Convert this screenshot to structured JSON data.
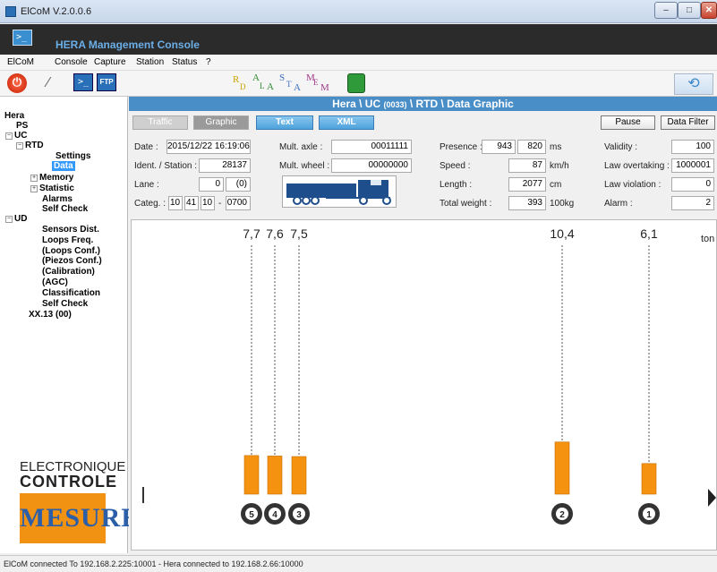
{
  "window": {
    "title": "ElCoM V.2.0.0.6",
    "min": "–",
    "max": "□",
    "close": "✕"
  },
  "banner": {
    "title": "HERA Management Console",
    "icon_glyph": ">_"
  },
  "menu": [
    "ElCoM",
    "Console",
    "Capture",
    "Station",
    "Status",
    "?"
  ],
  "toolbar": {
    "power_icon": "power-icon",
    "cmd_glyph": ">_",
    "ftp_label": "FTP",
    "rlsm": [
      "R",
      "D",
      "A",
      "L",
      "S",
      "T",
      "M",
      "E",
      "M",
      "A",
      "L",
      "A"
    ],
    "refresh_glyph": "⟲"
  },
  "tree": {
    "hera": "Hera",
    "ps": "PS",
    "uc": "UC",
    "rtd": "RTD",
    "settings": "Settings",
    "data": "Data",
    "memory": "Memory",
    "statistic": "Statistic",
    "alarms": "Alarms",
    "uc_self_check": "Self Check",
    "ud": "UD",
    "sensors_dist": "Sensors Dist.",
    "loops_freq": "Loops Freq.",
    "loops_conf": "(Loops Conf.)",
    "piezos_conf": "(Piezos Conf.)",
    "calibration": "(Calibration)",
    "agc": "(AGC)",
    "classification": "Classification",
    "ud_self_check": "Self Check",
    "xx13": "XX.13 (00)"
  },
  "logo": {
    "line1": "ELECTRONIQUE",
    "line2": "CONTROLE",
    "line3": "MESURE"
  },
  "breadcrumb": {
    "pre": "Hera \\ UC ",
    "code": "(0033)",
    "post": " \\ RTD \\ Data Graphic"
  },
  "tabs": {
    "traffic": "Traffic",
    "graphic": "Graphic",
    "text": "Text",
    "xml": "XML",
    "pause": "Pause",
    "data_filter": "Data Filter"
  },
  "fields": {
    "date_label": "Date :",
    "date": "2015/12/22 16:19:06",
    "ident_label": "Ident. / Station :",
    "ident": "28137",
    "lane_label": "Lane :",
    "lane": "0",
    "lane2": "(0)",
    "categ_label": "Categ. :",
    "categ": [
      "10",
      "41",
      "10",
      "-",
      "0700"
    ],
    "mult_axle_label": "Mult. axle :",
    "mult_axle": "00011111",
    "mult_wheel_label": "Mult. wheel :",
    "mult_wheel": "00000000",
    "presence_label": "Presence :",
    "presence1": "943",
    "presence2": "820",
    "presence_unit": "ms",
    "speed_label": "Speed :",
    "speed": "87",
    "speed_unit": "km/h",
    "length_label": "Length :",
    "length": "2077",
    "length_unit": "cm",
    "total_weight_label": "Total weight :",
    "total_weight": "393",
    "total_weight_unit": "100kg",
    "validity_label": "Validity :",
    "validity": "100",
    "law_overtaking_label": "Law overtaking :",
    "law_overtaking": "1000001",
    "law_violation_label": "Law violation :",
    "law_violation": "0",
    "alarm_label": "Alarm :",
    "alarm": "2"
  },
  "axles": {
    "unit": "ton",
    "items": [
      {
        "num": "5",
        "weight": "7,7"
      },
      {
        "num": "4",
        "weight": "7,6"
      },
      {
        "num": "3",
        "weight": "7,5"
      },
      {
        "num": "2",
        "weight": "10,4"
      },
      {
        "num": "1",
        "weight": "6,1"
      }
    ],
    "bar_color": "#f5920f"
  },
  "status": "ElCoM connected To 192.168.2.225:10001  -  Hera connected to 192.168.2.66:10000"
}
